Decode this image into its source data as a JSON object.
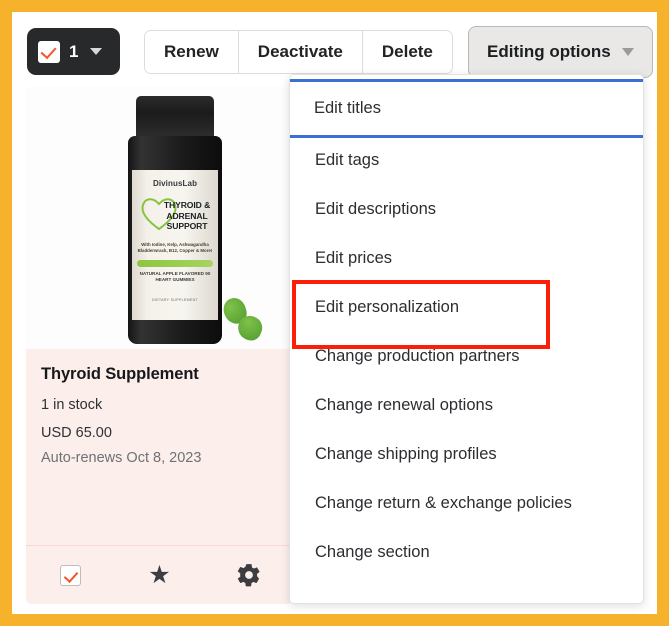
{
  "frame": {
    "accent_color": "#f7b22b"
  },
  "toolbar": {
    "selection": {
      "count": "1",
      "checkbox_icon": "check-icon",
      "caret_icon": "chevron-down-icon"
    },
    "buttons": [
      {
        "label": "Renew",
        "name": "renew-button"
      },
      {
        "label": "Deactivate",
        "name": "deactivate-button"
      },
      {
        "label": "Delete",
        "name": "delete-button"
      }
    ],
    "editing_options": {
      "label": "Editing options",
      "caret_icon": "chevron-down-icon",
      "state": "active"
    }
  },
  "product_card": {
    "title": "Thyroid Supplement",
    "stock": "1 in stock",
    "price": "USD 65.00",
    "renewal": "Auto-renews Oct 8, 2023",
    "image": {
      "brand": "DivinusLab",
      "product_name": "THYROID & ADRENAL SUPPORT",
      "ingredients": "With Iodine, Kelp, Ashwagandha Bladderwrack, B12, Copper & More!",
      "flavor": "NATURAL APPLE FLAVORED 90 HEART GUMMIES",
      "supplement_note": "DIETARY SUPPLEMENT",
      "heart_icon": "heart-outline-icon"
    },
    "footer_icons": [
      {
        "name": "select-checkbox",
        "icon": "checkbox-checked-icon"
      },
      {
        "name": "favorite-button",
        "icon": "star-icon",
        "glyph": "★"
      },
      {
        "name": "settings-button",
        "icon": "gear-icon"
      }
    ]
  },
  "dropdown": {
    "items": [
      {
        "label": "Edit titles",
        "highlight": "blue"
      },
      {
        "label": "Edit tags",
        "highlight": "none"
      },
      {
        "label": "Edit descriptions",
        "highlight": "none"
      },
      {
        "label": "Edit prices",
        "highlight": "none"
      },
      {
        "label": "Edit personalization",
        "highlight": "red"
      },
      {
        "label": "Change production partners",
        "highlight": "none"
      },
      {
        "label": "Change renewal options",
        "highlight": "none"
      },
      {
        "label": "Change shipping profiles",
        "highlight": "none"
      },
      {
        "label": "Change return & exchange policies",
        "highlight": "none"
      },
      {
        "label": "Change section",
        "highlight": "none"
      }
    ],
    "highlight_colors": {
      "blue": "#3b6fd4",
      "red": "#fb1e09"
    }
  }
}
